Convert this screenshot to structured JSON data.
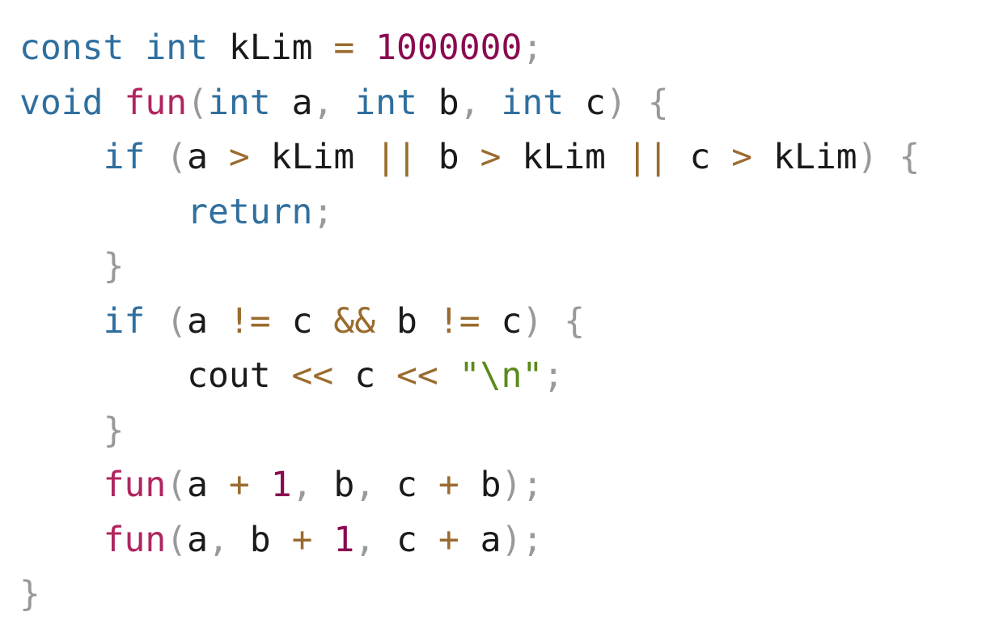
{
  "editor": {
    "colors": {
      "keyword": "#2f6f9f",
      "number": "#8b0a50",
      "function": "#b0255f",
      "operator": "#9a6b2f",
      "string": "#5a8a1a",
      "punctuation": "#999999",
      "identifier": "#1a1a1a",
      "background": "#ffffff"
    },
    "lines": [
      {
        "tokens": [
          {
            "t": "const",
            "c": "keyword"
          },
          {
            "t": " ",
            "c": "identifier"
          },
          {
            "t": "int",
            "c": "keyword"
          },
          {
            "t": " kLim ",
            "c": "identifier"
          },
          {
            "t": "=",
            "c": "operator"
          },
          {
            "t": " ",
            "c": "identifier"
          },
          {
            "t": "1000000",
            "c": "number"
          },
          {
            "t": ";",
            "c": "punctuation"
          }
        ]
      },
      {
        "tokens": [
          {
            "t": "void",
            "c": "keyword"
          },
          {
            "t": " ",
            "c": "identifier"
          },
          {
            "t": "fun",
            "c": "function"
          },
          {
            "t": "(",
            "c": "punctuation"
          },
          {
            "t": "int",
            "c": "keyword"
          },
          {
            "t": " a",
            "c": "identifier"
          },
          {
            "t": ",",
            "c": "punctuation"
          },
          {
            "t": " ",
            "c": "identifier"
          },
          {
            "t": "int",
            "c": "keyword"
          },
          {
            "t": " b",
            "c": "identifier"
          },
          {
            "t": ",",
            "c": "punctuation"
          },
          {
            "t": " ",
            "c": "identifier"
          },
          {
            "t": "int",
            "c": "keyword"
          },
          {
            "t": " c",
            "c": "identifier"
          },
          {
            "t": ")",
            "c": "punctuation"
          },
          {
            "t": " ",
            "c": "identifier"
          },
          {
            "t": "{",
            "c": "punctuation"
          }
        ]
      },
      {
        "tokens": [
          {
            "t": "    ",
            "c": "identifier"
          },
          {
            "t": "if",
            "c": "keyword"
          },
          {
            "t": " ",
            "c": "identifier"
          },
          {
            "t": "(",
            "c": "punctuation"
          },
          {
            "t": "a ",
            "c": "identifier"
          },
          {
            "t": ">",
            "c": "operator"
          },
          {
            "t": " kLim ",
            "c": "identifier"
          },
          {
            "t": "||",
            "c": "operator"
          },
          {
            "t": " b ",
            "c": "identifier"
          },
          {
            "t": ">",
            "c": "operator"
          },
          {
            "t": " kLim ",
            "c": "identifier"
          },
          {
            "t": "||",
            "c": "operator"
          },
          {
            "t": " c ",
            "c": "identifier"
          },
          {
            "t": ">",
            "c": "operator"
          },
          {
            "t": " kLim",
            "c": "identifier"
          },
          {
            "t": ")",
            "c": "punctuation"
          },
          {
            "t": " ",
            "c": "identifier"
          },
          {
            "t": "{",
            "c": "punctuation"
          }
        ]
      },
      {
        "tokens": [
          {
            "t": "        ",
            "c": "identifier"
          },
          {
            "t": "return",
            "c": "keyword"
          },
          {
            "t": ";",
            "c": "punctuation"
          }
        ]
      },
      {
        "tokens": [
          {
            "t": "    ",
            "c": "identifier"
          },
          {
            "t": "}",
            "c": "punctuation"
          }
        ]
      },
      {
        "tokens": [
          {
            "t": "    ",
            "c": "identifier"
          },
          {
            "t": "if",
            "c": "keyword"
          },
          {
            "t": " ",
            "c": "identifier"
          },
          {
            "t": "(",
            "c": "punctuation"
          },
          {
            "t": "a ",
            "c": "identifier"
          },
          {
            "t": "!=",
            "c": "operator"
          },
          {
            "t": " c ",
            "c": "identifier"
          },
          {
            "t": "&&",
            "c": "operator"
          },
          {
            "t": " b ",
            "c": "identifier"
          },
          {
            "t": "!=",
            "c": "operator"
          },
          {
            "t": " c",
            "c": "identifier"
          },
          {
            "t": ")",
            "c": "punctuation"
          },
          {
            "t": " ",
            "c": "identifier"
          },
          {
            "t": "{",
            "c": "punctuation"
          }
        ]
      },
      {
        "tokens": [
          {
            "t": "        cout ",
            "c": "identifier"
          },
          {
            "t": "<<",
            "c": "operator"
          },
          {
            "t": " c ",
            "c": "identifier"
          },
          {
            "t": "<<",
            "c": "operator"
          },
          {
            "t": " ",
            "c": "identifier"
          },
          {
            "t": "\"\\n\"",
            "c": "string"
          },
          {
            "t": ";",
            "c": "punctuation"
          }
        ]
      },
      {
        "tokens": [
          {
            "t": "    ",
            "c": "identifier"
          },
          {
            "t": "}",
            "c": "punctuation"
          }
        ]
      },
      {
        "tokens": [
          {
            "t": "    ",
            "c": "identifier"
          },
          {
            "t": "fun",
            "c": "function"
          },
          {
            "t": "(",
            "c": "punctuation"
          },
          {
            "t": "a ",
            "c": "identifier"
          },
          {
            "t": "+",
            "c": "operator"
          },
          {
            "t": " ",
            "c": "identifier"
          },
          {
            "t": "1",
            "c": "number"
          },
          {
            "t": ",",
            "c": "punctuation"
          },
          {
            "t": " b",
            "c": "identifier"
          },
          {
            "t": ",",
            "c": "punctuation"
          },
          {
            "t": " c ",
            "c": "identifier"
          },
          {
            "t": "+",
            "c": "operator"
          },
          {
            "t": " b",
            "c": "identifier"
          },
          {
            "t": ");",
            "c": "punctuation"
          }
        ]
      },
      {
        "tokens": [
          {
            "t": "    ",
            "c": "identifier"
          },
          {
            "t": "fun",
            "c": "function"
          },
          {
            "t": "(",
            "c": "punctuation"
          },
          {
            "t": "a",
            "c": "identifier"
          },
          {
            "t": ",",
            "c": "punctuation"
          },
          {
            "t": " b ",
            "c": "identifier"
          },
          {
            "t": "+",
            "c": "operator"
          },
          {
            "t": " ",
            "c": "identifier"
          },
          {
            "t": "1",
            "c": "number"
          },
          {
            "t": ",",
            "c": "punctuation"
          },
          {
            "t": " c ",
            "c": "identifier"
          },
          {
            "t": "+",
            "c": "operator"
          },
          {
            "t": " a",
            "c": "identifier"
          },
          {
            "t": ");",
            "c": "punctuation"
          }
        ]
      },
      {
        "tokens": [
          {
            "t": "}",
            "c": "punctuation"
          }
        ]
      }
    ]
  }
}
